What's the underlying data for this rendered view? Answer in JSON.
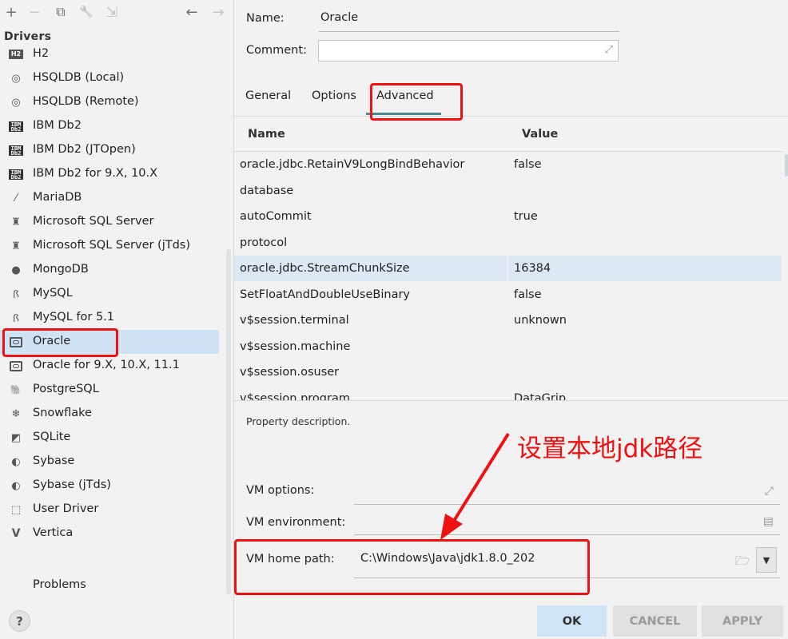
{
  "toolbar": {
    "add_icon": "+",
    "remove_icon": "−",
    "duplicate_icon": "⧉",
    "wrench_icon": "🔧",
    "move_icon": "⇲",
    "back_icon": "←",
    "forward_icon": "→"
  },
  "sidebar": {
    "title": "Drivers",
    "items": [
      {
        "label": "H2",
        "icon": "h2-icon"
      },
      {
        "label": "HSQLDB (Local)",
        "icon": "hsqldb-icon"
      },
      {
        "label": "HSQLDB (Remote)",
        "icon": "hsqldb-icon"
      },
      {
        "label": "IBM Db2",
        "icon": "ibm-db2-icon"
      },
      {
        "label": "IBM Db2 (JTOpen)",
        "icon": "ibm-db2-icon"
      },
      {
        "label": "IBM Db2 for 9.X, 10.X",
        "icon": "ibm-db2-icon"
      },
      {
        "label": "MariaDB",
        "icon": "mariadb-icon"
      },
      {
        "label": "Microsoft SQL Server",
        "icon": "mssql-icon"
      },
      {
        "label": "Microsoft SQL Server (jTds)",
        "icon": "mssql-icon"
      },
      {
        "label": "MongoDB",
        "icon": "mongodb-icon"
      },
      {
        "label": "MySQL",
        "icon": "mysql-icon"
      },
      {
        "label": "MySQL for 5.1",
        "icon": "mysql-icon"
      },
      {
        "label": "Oracle",
        "icon": "oracle-icon"
      },
      {
        "label": "Oracle for 9.X, 10.X, 11.1",
        "icon": "oracle-icon"
      },
      {
        "label": "PostgreSQL",
        "icon": "postgresql-icon"
      },
      {
        "label": "Snowflake",
        "icon": "snowflake-icon"
      },
      {
        "label": "SQLite",
        "icon": "sqlite-icon"
      },
      {
        "label": "Sybase",
        "icon": "sybase-icon"
      },
      {
        "label": "Sybase (jTds)",
        "icon": "sybase-icon"
      },
      {
        "label": "User Driver",
        "icon": "user-driver-icon"
      },
      {
        "label": "Vertica",
        "icon": "vertica-icon"
      }
    ],
    "selected": "Oracle",
    "h2_badge": "H2",
    "ibm_badge": "IBM\nDb2",
    "problems_label": "Problems",
    "help_label": "?"
  },
  "form": {
    "name_label": "Name:",
    "name_value": "Oracle",
    "comment_label": "Comment:",
    "comment_value": ""
  },
  "tabs": [
    {
      "label": "General"
    },
    {
      "label": "Options"
    },
    {
      "label": "Advanced"
    }
  ],
  "active_tab": "Advanced",
  "properties": {
    "headers": {
      "name": "Name",
      "value": "Value"
    },
    "rows": [
      {
        "name": "oracle.jdbc.RetainV9LongBindBehavior",
        "value": "false"
      },
      {
        "name": "database",
        "value": ""
      },
      {
        "name": "autoCommit",
        "value": "true"
      },
      {
        "name": "protocol",
        "value": ""
      },
      {
        "name": "oracle.jdbc.StreamChunkSize",
        "value": "16384"
      },
      {
        "name": "SetFloatAndDoubleUseBinary",
        "value": "false"
      },
      {
        "name": "v$session.terminal",
        "value": "unknown"
      },
      {
        "name": "v$session.machine",
        "value": ""
      },
      {
        "name": "v$session.osuser",
        "value": ""
      },
      {
        "name": "v$session.program",
        "value": "DataGrip"
      }
    ],
    "selected_row": "oracle.jdbc.StreamChunkSize"
  },
  "description": {
    "text": "Property description."
  },
  "vm": {
    "options_label": "VM options:",
    "options_value": "",
    "environment_label": "VM environment:",
    "environment_value": "",
    "home_path_label": "VM home path:",
    "home_path_value": "C:\\Windows\\Java\\jdk1.8.0_202"
  },
  "annotation": {
    "text": "设置本地jdk路径",
    "color": "#ee1111"
  },
  "buttons": {
    "ok": "OK",
    "cancel": "CANCEL",
    "apply": "APPLY"
  },
  "colors": {
    "selection": "#cfe3f5",
    "tab_underline": "#4a8a8f",
    "highlight_box": "#ee1111",
    "ok_button": "#cfe4f7"
  }
}
